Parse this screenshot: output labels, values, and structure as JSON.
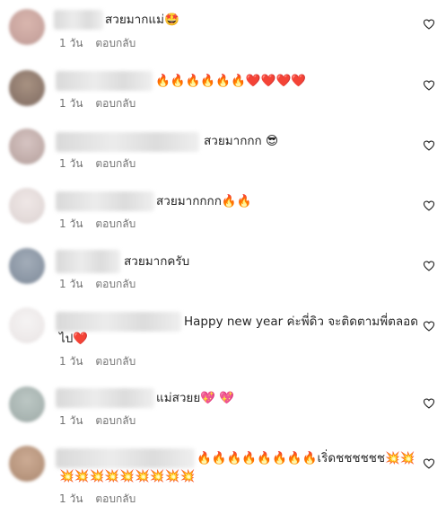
{
  "comments": [
    {
      "text": "สวยมากแม่🤩",
      "time": "1 วัน",
      "reply": "ตอบกลับ",
      "avatar": "#caa6a0"
    },
    {
      "text": "🔥🔥🔥🔥🔥🔥❤️❤️❤️❤️",
      "time": "1 วัน",
      "reply": "ตอบกลับ",
      "avatar": "#9b8478"
    },
    {
      "text": "สวยมากกก 😎",
      "time": "1 วัน",
      "reply": "ตอบกลับ",
      "avatar": "#c7b3b1"
    },
    {
      "text": "สวยมากกกก🔥🔥",
      "time": "1 วัน",
      "reply": "ตอบกลับ",
      "avatar": "#e7dedd"
    },
    {
      "text": "สวยมากครับ",
      "time": "1 วัน",
      "reply": "ตอบกลับ",
      "avatar": "#8d98a6"
    },
    {
      "text": "Happy new year ค่ะพี่ดิว จะติดตามพี่ตลอด",
      "text2": "ไป❤️",
      "time": "1 วัน",
      "reply": "ตอบกลับ",
      "avatar": "#f0eeee"
    },
    {
      "text": "แม่สวยย💖 💖",
      "time": "1 วัน",
      "reply": "ตอบกลับ",
      "avatar": "#aab6b3"
    },
    {
      "text": "🔥🔥🔥🔥🔥🔥🔥🔥เริ่ดชชชชชช💥💥",
      "text2": "💥💥💥💥💥💥💥💥💥",
      "time": "1 วัน",
      "reply": "ตอบกลับ",
      "avatar": "#b9977f"
    }
  ],
  "like_icon": "heart-outline-icon"
}
